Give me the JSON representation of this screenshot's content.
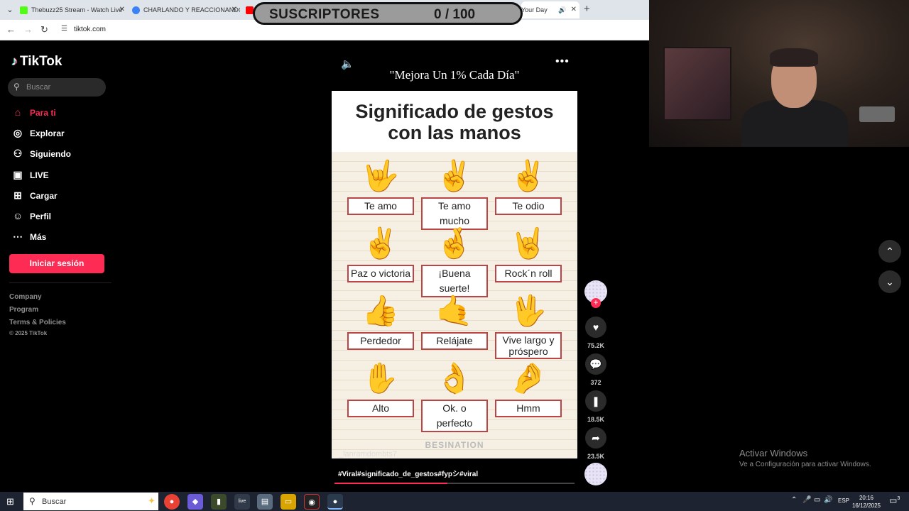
{
  "browser": {
    "tabs": [
      {
        "label": "Thebuzz25 Stream - Watch Live",
        "favicon_color": "#53fc18"
      },
      {
        "label": "CHARLANDO Y REACCIONANDO",
        "favicon_color": "#3b82f6"
      },
      {
        "label": "Your Day",
        "favicon_color": "#ff0000"
      }
    ],
    "url": "tiktok.com"
  },
  "overlay": {
    "subs_label": "SUSCRIPTORES",
    "subs_count": "0 / 100"
  },
  "tiktok": {
    "logo": "TikTok",
    "search_placeholder": "Buscar",
    "nav": [
      {
        "label": "Para ti",
        "icon": "home-icon",
        "active": true
      },
      {
        "label": "Explorar",
        "icon": "compass-icon"
      },
      {
        "label": "Siguiendo",
        "icon": "following-icon"
      },
      {
        "label": "LIVE",
        "icon": "live-icon"
      },
      {
        "label": "Cargar",
        "icon": "upload-icon"
      },
      {
        "label": "Perfil",
        "icon": "profile-icon"
      },
      {
        "label": "Más",
        "icon": "more-icon"
      }
    ],
    "login_label": "Iniciar sesión",
    "footer": [
      "Company",
      "Program",
      "Terms & Policies"
    ],
    "copyright": "© 2025 TikTok"
  },
  "video": {
    "top_caption": "\"Mejora Un 1% Cada Día\"",
    "title_line1": "Significado de gestos",
    "title_line2": "con las manos",
    "gestures": [
      {
        "label": "Te amo",
        "hand": "🤟"
      },
      {
        "label": "Te amo mucho",
        "hand": "✌"
      },
      {
        "label": "Te odio",
        "hand": "✌"
      },
      {
        "label": "Paz o victoria",
        "hand": "✌"
      },
      {
        "label": "¡Buena suerte!",
        "hand": "🤞"
      },
      {
        "label": "Rock´n roll",
        "hand": "🤘"
      },
      {
        "label": "Perdedor",
        "hand": "👍"
      },
      {
        "label": "Relájate",
        "hand": "🤙"
      },
      {
        "label": "Vive largo y próspero",
        "hand": "🖖"
      },
      {
        "label": "Alto",
        "hand": "✋"
      },
      {
        "label": "Ok. o perfecto",
        "hand": "👌"
      },
      {
        "label": "Hmm",
        "hand": "🤌"
      }
    ],
    "watermark": "BESINATION",
    "username_overlay": "_lanramdombts7",
    "hashtags": "#Viral#significado_de_gestos#fypシ#viral",
    "progress": 0.47
  },
  "actions": {
    "likes": "75.2K",
    "comments": "372",
    "saves": "18.5K",
    "shares": "23.5K"
  },
  "windows": {
    "activate_title": "Activar Windows",
    "activate_sub": "Ve a Configuración para activar Windows.",
    "taskbar_search": "Buscar",
    "lang": "ESP",
    "time": "20:16",
    "date": "16/12/2025",
    "notification_count": "3"
  }
}
